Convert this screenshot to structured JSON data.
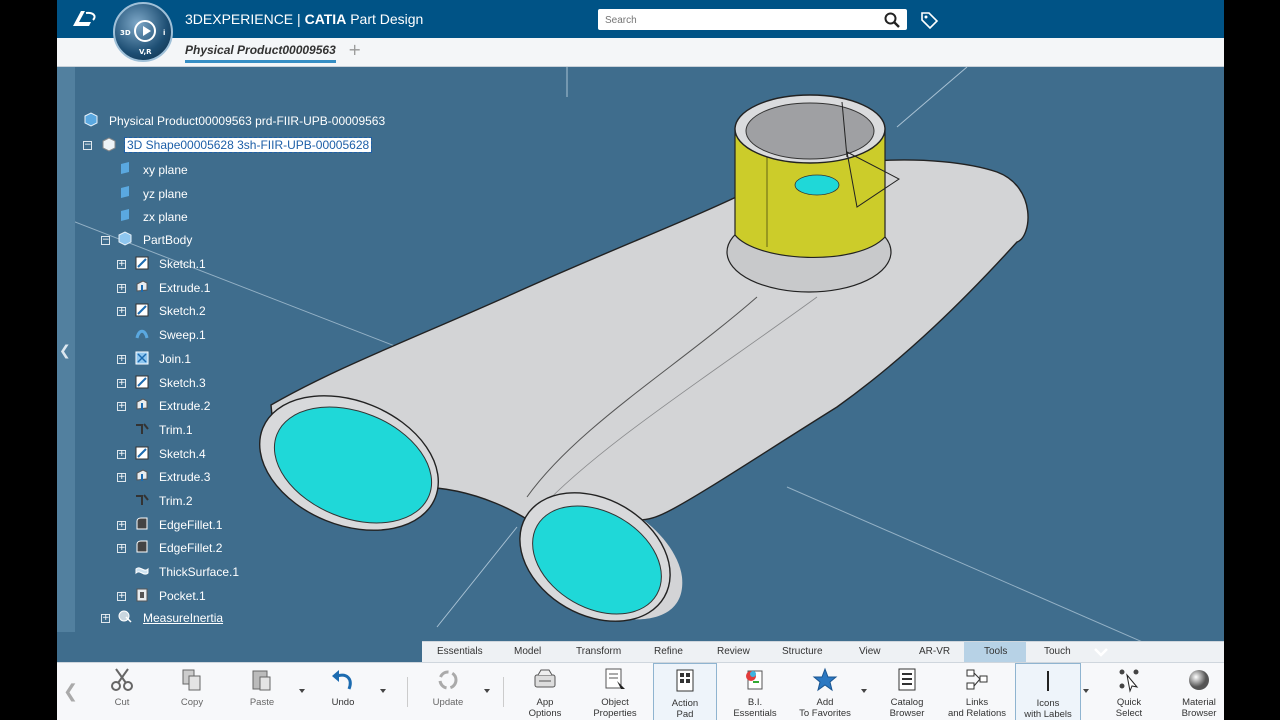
{
  "header": {
    "brand": "3DEXPERIENCE",
    "app_separator": "|",
    "app_name_bold": "CATIA",
    "app_name": "Part Design",
    "compass_labels": {
      "left": "3D",
      "right": "i",
      "bottom": "V,R"
    },
    "search_placeholder": "Search"
  },
  "tabs": {
    "active": "Physical Product00009563",
    "add": "+"
  },
  "tree": {
    "root": "Physical Product00009563 prd-FIIR-UPB-00009563",
    "shape": "3D Shape00005628 3sh-FIIR-UPB-00005628",
    "planes": [
      "xy plane",
      "yz plane",
      "zx plane"
    ],
    "partbody": "PartBody",
    "features": [
      {
        "label": "Sketch.1",
        "icon": "sketch-icon",
        "expandable": true
      },
      {
        "label": "Extrude.1",
        "icon": "extrude-icon",
        "expandable": true
      },
      {
        "label": "Sketch.2",
        "icon": "sketch-icon",
        "expandable": true
      },
      {
        "label": "Sweep.1",
        "icon": "sweep-icon",
        "expandable": false
      },
      {
        "label": "Join.1",
        "icon": "join-icon",
        "expandable": true
      },
      {
        "label": "Sketch.3",
        "icon": "sketch-icon",
        "expandable": true
      },
      {
        "label": "Extrude.2",
        "icon": "extrude-icon",
        "expandable": true
      },
      {
        "label": "Trim.1",
        "icon": "trim-icon",
        "expandable": false
      },
      {
        "label": "Sketch.4",
        "icon": "sketch-icon",
        "expandable": true
      },
      {
        "label": "Extrude.3",
        "icon": "extrude-icon",
        "expandable": true
      },
      {
        "label": "Trim.2",
        "icon": "trim-icon",
        "expandable": false
      },
      {
        "label": "EdgeFillet.1",
        "icon": "edge-fillet-icon",
        "expandable": true
      },
      {
        "label": "EdgeFillet.2",
        "icon": "edge-fillet-icon",
        "expandable": true
      },
      {
        "label": "ThickSurface.1",
        "icon": "thick-surface-icon",
        "expandable": false
      },
      {
        "label": "Pocket.1",
        "icon": "pocket-icon",
        "expandable": true
      }
    ],
    "measure": "MeasureInertia"
  },
  "command_tabs": [
    "Essentials",
    "Model",
    "Transform",
    "Refine",
    "Review",
    "Structure",
    "View",
    "AR-VR",
    "Tools",
    "Touch"
  ],
  "command_tab_active": "Tools",
  "toolbar": {
    "cut": "Cut",
    "copy": "Copy",
    "paste": "Paste",
    "undo": "Undo",
    "update": "Update",
    "app_options": [
      "App",
      "Options"
    ],
    "object_properties": [
      "Object",
      "Properties"
    ],
    "action_pad": [
      "Action",
      "Pad"
    ],
    "bi_essentials": [
      "B.I.",
      "Essentials"
    ],
    "add_favorites": [
      "Add",
      "To Favorites"
    ],
    "catalog_browser": [
      "Catalog",
      "Browser"
    ],
    "links_relations": [
      "Links",
      "and Relations"
    ],
    "icons_labels": [
      "Icons",
      "with Labels"
    ],
    "quick_select": [
      "Quick",
      "Select"
    ],
    "material_browser": [
      "Material",
      "Browser"
    ]
  },
  "colors": {
    "header_blue": "#005386",
    "viewport": "#3f6d8d",
    "part_grey": "#d3d4d6",
    "inner_cyan": "#1fd8d8",
    "cylinder_yellow": "#cccc2a",
    "active_tab": "#b7d2e6"
  }
}
